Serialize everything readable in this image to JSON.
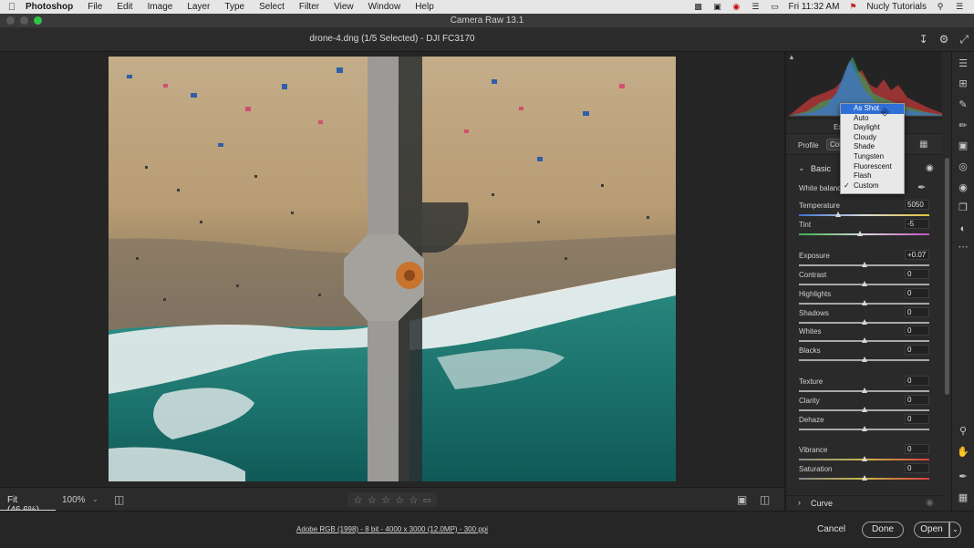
{
  "menubar": {
    "apple_icon": "apple-icon",
    "app_name": "Photoshop",
    "items": [
      "File",
      "Edit",
      "Image",
      "Layer",
      "Type",
      "Select",
      "Filter",
      "View",
      "Window",
      "Help"
    ],
    "clock": "Fri 11:32 AM",
    "user": "Nucly Tutorials"
  },
  "window": {
    "title": "Camera Raw 13.1"
  },
  "header": {
    "filename": "drone-4.dng (1/5 Selected)  -  DJI FC3170"
  },
  "viewbar": {
    "fit_label": "Fit (46.6%)",
    "zoom_label": "100%",
    "rating_stars": 5
  },
  "footer": {
    "info": "Adobe RGB (1998) - 8 bit - 4000 x 3000 (12.0MP) - 300 ppi",
    "cancel": "Cancel",
    "done": "Done",
    "open": "Open"
  },
  "panel": {
    "tab_partial": "Ex",
    "profile_label": "Profile",
    "profile_value": "Colo",
    "basic_title": "Basic",
    "white_balance_label": "White balance",
    "curve_title": "Curve",
    "sliders": [
      {
        "name": "Temperature",
        "value": "5050",
        "pos": 0.3,
        "gradient": "temp"
      },
      {
        "name": "Tint",
        "value": "-5",
        "pos": 0.47,
        "gradient": "tint"
      },
      {
        "name": "Exposure",
        "value": "+0.07",
        "pos": 0.505,
        "gradient": "none"
      },
      {
        "name": "Contrast",
        "value": "0",
        "pos": 0.5,
        "gradient": "none"
      },
      {
        "name": "Highlights",
        "value": "0",
        "pos": 0.5,
        "gradient": "none"
      },
      {
        "name": "Shadows",
        "value": "0",
        "pos": 0.5,
        "gradient": "none"
      },
      {
        "name": "Whites",
        "value": "0",
        "pos": 0.5,
        "gradient": "none"
      },
      {
        "name": "Blacks",
        "value": "0",
        "pos": 0.5,
        "gradient": "none"
      },
      {
        "name": "Texture",
        "value": "0",
        "pos": 0.5,
        "gradient": "none"
      },
      {
        "name": "Clarity",
        "value": "0",
        "pos": 0.5,
        "gradient": "none"
      },
      {
        "name": "Dehaze",
        "value": "0",
        "pos": 0.5,
        "gradient": "none"
      },
      {
        "name": "Vibrance",
        "value": "0",
        "pos": 0.5,
        "gradient": "vib"
      },
      {
        "name": "Saturation",
        "value": "0",
        "pos": 0.5,
        "gradient": "sat"
      }
    ]
  },
  "white_balance_menu": {
    "options": [
      "As Shot",
      "Auto",
      "Daylight",
      "Cloudy",
      "Shade",
      "Tungsten",
      "Fluorescent",
      "Flash",
      "Custom"
    ],
    "highlighted": "As Shot",
    "checked": "Custom"
  },
  "colors": {
    "accent": "#2f6fd6",
    "panel_bg": "#2a2a2a",
    "sand": "#b19a76",
    "ocean": "#1c6b66"
  }
}
